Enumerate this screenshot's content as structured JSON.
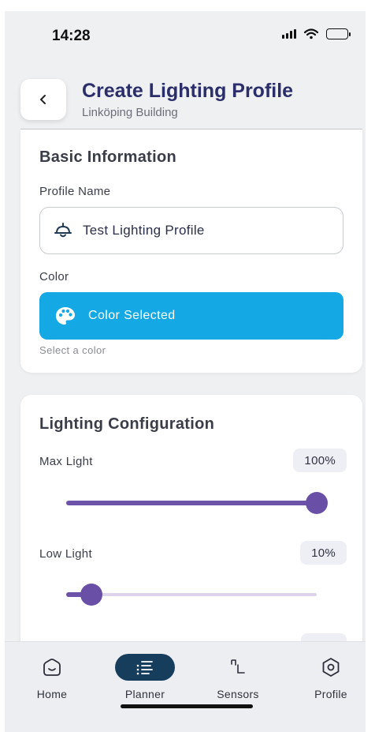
{
  "status_bar": {
    "time": "14:28"
  },
  "header": {
    "title": "Create Lighting Profile",
    "subtitle": "Linköping Building"
  },
  "basic_info": {
    "section_title": "Basic Information",
    "profile_name_label": "Profile Name",
    "profile_name_value": "Test Lighting Profile",
    "color_label": "Color",
    "color_button_label": "Color Selected",
    "color_hint": "Select a color",
    "selected_color": "#14a8e4"
  },
  "lighting_config": {
    "section_title": "Lighting Configuration",
    "max_light": {
      "label": "Max Light",
      "display": "100%",
      "value": 100
    },
    "low_light": {
      "label": "Low Light",
      "display": "10%",
      "value": 10
    }
  },
  "bottom_nav": {
    "items": [
      {
        "label": "Home",
        "icon": "home-icon"
      },
      {
        "label": "Planner",
        "icon": "planner-icon",
        "active": true
      },
      {
        "label": "Sensors",
        "icon": "sensor-icon"
      },
      {
        "label": "Profile",
        "icon": "profile-icon"
      }
    ]
  },
  "colors": {
    "accent": "#6a4fa6",
    "title": "#2b2e6a",
    "nav_active": "#173d5c"
  }
}
